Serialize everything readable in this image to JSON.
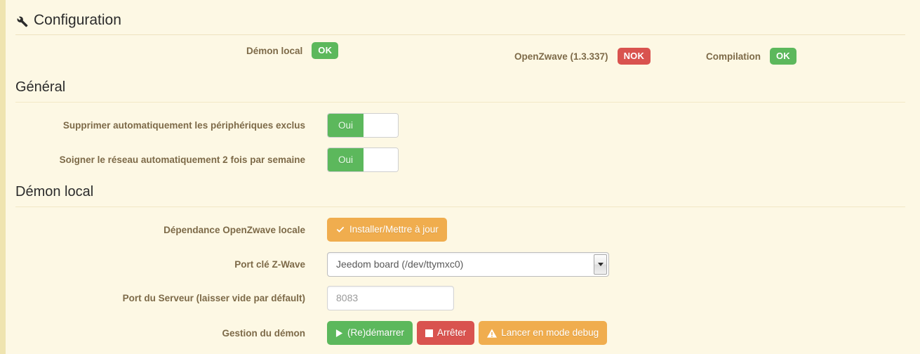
{
  "panel": {
    "title": "Configuration",
    "icon": "wrench-icon"
  },
  "status": {
    "items": [
      {
        "label": "Démon local",
        "badge": "OK",
        "state": "ok"
      },
      {
        "label": "OpenZwave (1.3.337)",
        "badge": "NOK",
        "state": "nok"
      },
      {
        "label": "Compilation",
        "badge": "OK",
        "state": "ok"
      }
    ]
  },
  "sections": {
    "general": {
      "heading": "Général",
      "rows": [
        {
          "label": "Supprimer automatiquement les périphériques exclus",
          "toggle": "Oui"
        },
        {
          "label": "Soigner le réseau automatiquement 2 fois par semaine",
          "toggle": "Oui"
        }
      ]
    },
    "daemon": {
      "heading": "Démon local",
      "dependency": {
        "label": "Dépendance OpenZwave locale",
        "button": "Installer/Mettre à jour",
        "button_icon": "check-icon"
      },
      "port_key": {
        "label": "Port clé Z-Wave",
        "value": "Jeedom board (/dev/ttymxc0)"
      },
      "server_port": {
        "label": "Port du Serveur (laisser vide par défault)",
        "value": "",
        "placeholder": "8083"
      },
      "management": {
        "label": "Gestion du démon",
        "restart_button": "(Re)démarrer",
        "restart_icon": "play-icon",
        "stop_button": "Arrêter",
        "stop_icon": "stop-icon",
        "debug_button": "Lancer en mode debug",
        "debug_icon": "warning-icon"
      }
    }
  },
  "colors": {
    "background": "#fdf8e4",
    "left_accent": "#efe4b0",
    "label": "#7d6a48",
    "success": "#5cb85c",
    "danger": "#d9534f",
    "warning": "#f0ad4e"
  }
}
